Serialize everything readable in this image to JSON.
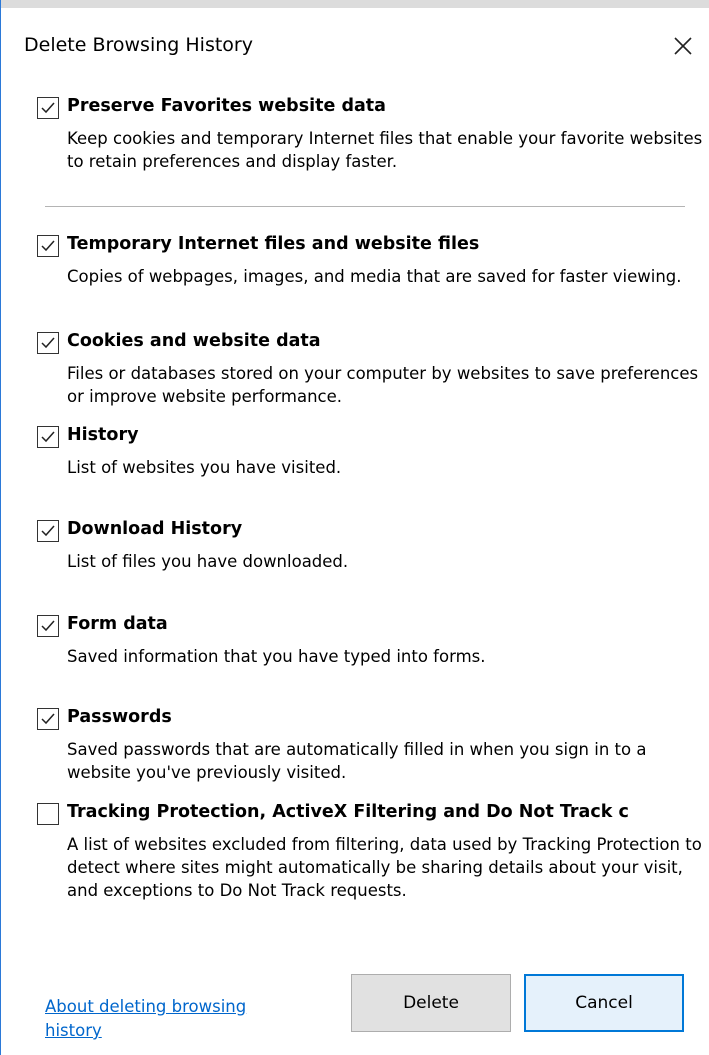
{
  "dialog": {
    "title": "Delete Browsing History",
    "close_icon": "close-icon"
  },
  "options": [
    {
      "label": "Preserve Favorites website data",
      "description": "Keep cookies and temporary Internet files that enable your favorite websites to retain preferences and display faster.",
      "checked": true
    },
    {
      "label": "Temporary Internet files and website files",
      "description": "Copies of webpages, images, and media that are saved for faster viewing.",
      "checked": true
    },
    {
      "label": "Cookies and website data",
      "description": "Files or databases stored on your computer by websites to save preferences or improve website performance.",
      "checked": true
    },
    {
      "label": "History",
      "description": "List of websites you have visited.",
      "checked": true
    },
    {
      "label": "Download History",
      "description": "List of files you have downloaded.",
      "checked": true
    },
    {
      "label": "Form data",
      "description": "Saved information that you have typed into forms.",
      "checked": true
    },
    {
      "label": "Passwords",
      "description": "Saved passwords that are automatically filled in when you sign in to a website you've previously visited.",
      "checked": true
    },
    {
      "label": "Tracking Protection, ActiveX Filtering and Do Not Track c",
      "description": "A list of websites excluded from filtering, data used by Tracking Protection to detect where sites might automatically be sharing details about your visit, and exceptions to Do Not Track requests.",
      "checked": false
    }
  ],
  "footer": {
    "about_link": "About deleting browsing history",
    "delete_label": "Delete",
    "cancel_label": "Cancel"
  },
  "colors": {
    "link": "#0066cc",
    "accent": "#0078d7"
  }
}
